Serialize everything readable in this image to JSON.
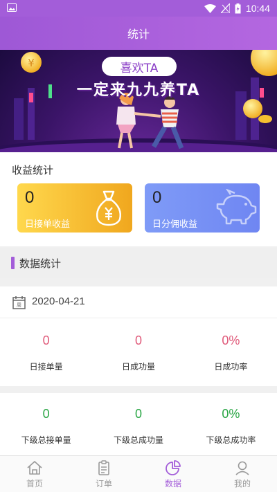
{
  "status_bar": {
    "time": "10:44",
    "icons": [
      "image-icon",
      "wifi-icon",
      "signal-icon",
      "battery-icon"
    ]
  },
  "app_bar": {
    "title": "统计"
  },
  "banner": {
    "tag": "喜欢TA",
    "headline": "一定来九九养TA"
  },
  "earnings": {
    "title": "收益统计",
    "cards": [
      {
        "value": "0",
        "label": "日接单收益",
        "icon": "money-bag-icon",
        "color": "#f2b427"
      },
      {
        "value": "0",
        "label": "日分佣收益",
        "icon": "piggy-bank-icon",
        "color": "#7891f5"
      }
    ]
  },
  "data_section": {
    "title": "数据统计",
    "accent": "#a35dd9"
  },
  "daily": {
    "date": "2020-04-21",
    "stats": [
      {
        "value": "0",
        "label": "日接单量"
      },
      {
        "value": "0",
        "label": "日成功量"
      },
      {
        "value": "0%",
        "label": "日成功率"
      }
    ]
  },
  "subordinate": {
    "stats": [
      {
        "value": "0",
        "label": "下级总接单量"
      },
      {
        "value": "0",
        "label": "下级总成功量"
      },
      {
        "value": "0%",
        "label": "下级总成功率"
      }
    ]
  },
  "tabbar": {
    "active": "数据",
    "tabs": [
      {
        "label": "首页",
        "icon": "home-icon"
      },
      {
        "label": "订单",
        "icon": "clipboard-icon"
      },
      {
        "label": "数据",
        "icon": "pie-chart-icon"
      },
      {
        "label": "我的",
        "icon": "user-icon"
      }
    ]
  }
}
